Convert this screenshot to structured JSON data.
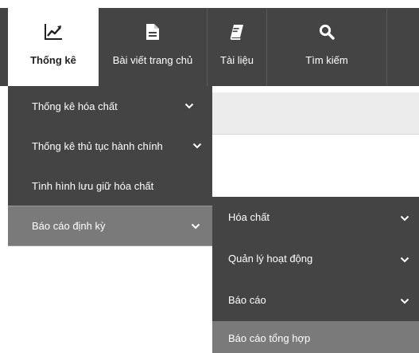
{
  "topnav": {
    "tabs": [
      {
        "label": "Thống kê",
        "icon": "chart-line-icon",
        "active": true
      },
      {
        "label": "Bài viết trang chủ",
        "icon": "document-icon",
        "active": false
      },
      {
        "label": "Tài liệu",
        "icon": "book-icon",
        "active": false
      },
      {
        "label": "Tìm kiếm",
        "icon": "search-icon",
        "active": false
      }
    ]
  },
  "submenu": {
    "items": [
      {
        "label": "Thống kê hóa chất",
        "icon": "chevron-down-icon"
      },
      {
        "label": "Thống kê thủ tục hành chính",
        "icon": "chevron-down-icon"
      },
      {
        "label": "Tình hình lưu giữ hóa chất"
      },
      {
        "label": "Báo cáo định kỳ",
        "icon": "chevron-down-icon",
        "active": true
      }
    ]
  },
  "submenu2": {
    "items": [
      {
        "label": "Hóa chất",
        "icon": "chevron-down-icon"
      },
      {
        "label": "Quản lý hoạt động",
        "icon": "chevron-down-icon"
      },
      {
        "label": "Báo cáo",
        "icon": "chevron-down-icon"
      },
      {
        "label": "Báo cáo tổng hợp",
        "active": true
      }
    ]
  },
  "colors": {
    "nav_bg": "#444444",
    "active_item_bg": "#7a7a7a",
    "text_light": "#ffffff",
    "text_dark": "#222222"
  }
}
